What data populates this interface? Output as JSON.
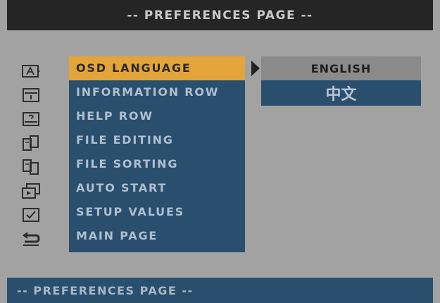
{
  "header": {
    "title": "-- PREFERENCES PAGE --"
  },
  "menu": {
    "items": [
      {
        "label": "OSD LANGUAGE",
        "icon": "language-icon",
        "selected": true
      },
      {
        "label": "INFORMATION ROW",
        "icon": "information-row-icon"
      },
      {
        "label": "HELP ROW",
        "icon": "help-row-icon"
      },
      {
        "label": "FILE EDITING",
        "icon": "file-editing-icon"
      },
      {
        "label": "FILE SORTING",
        "icon": "file-sorting-icon"
      },
      {
        "label": "AUTO START",
        "icon": "auto-start-icon"
      },
      {
        "label": "SETUP VALUES",
        "icon": "setup-values-icon"
      },
      {
        "label": "MAIN PAGE",
        "icon": "back-arrow-icon"
      }
    ]
  },
  "submenu": {
    "options": [
      {
        "label": "ENGLISH",
        "selected": true
      },
      {
        "label": "中文"
      }
    ]
  },
  "footer": {
    "title": "-- PREFERENCES PAGE --"
  },
  "colors": {
    "background": "#a2a2a2",
    "panel": "#2a4f6e",
    "highlight": "#e3a43a",
    "title_bar": "#252525",
    "sub_selected": "#8a8a8a"
  }
}
